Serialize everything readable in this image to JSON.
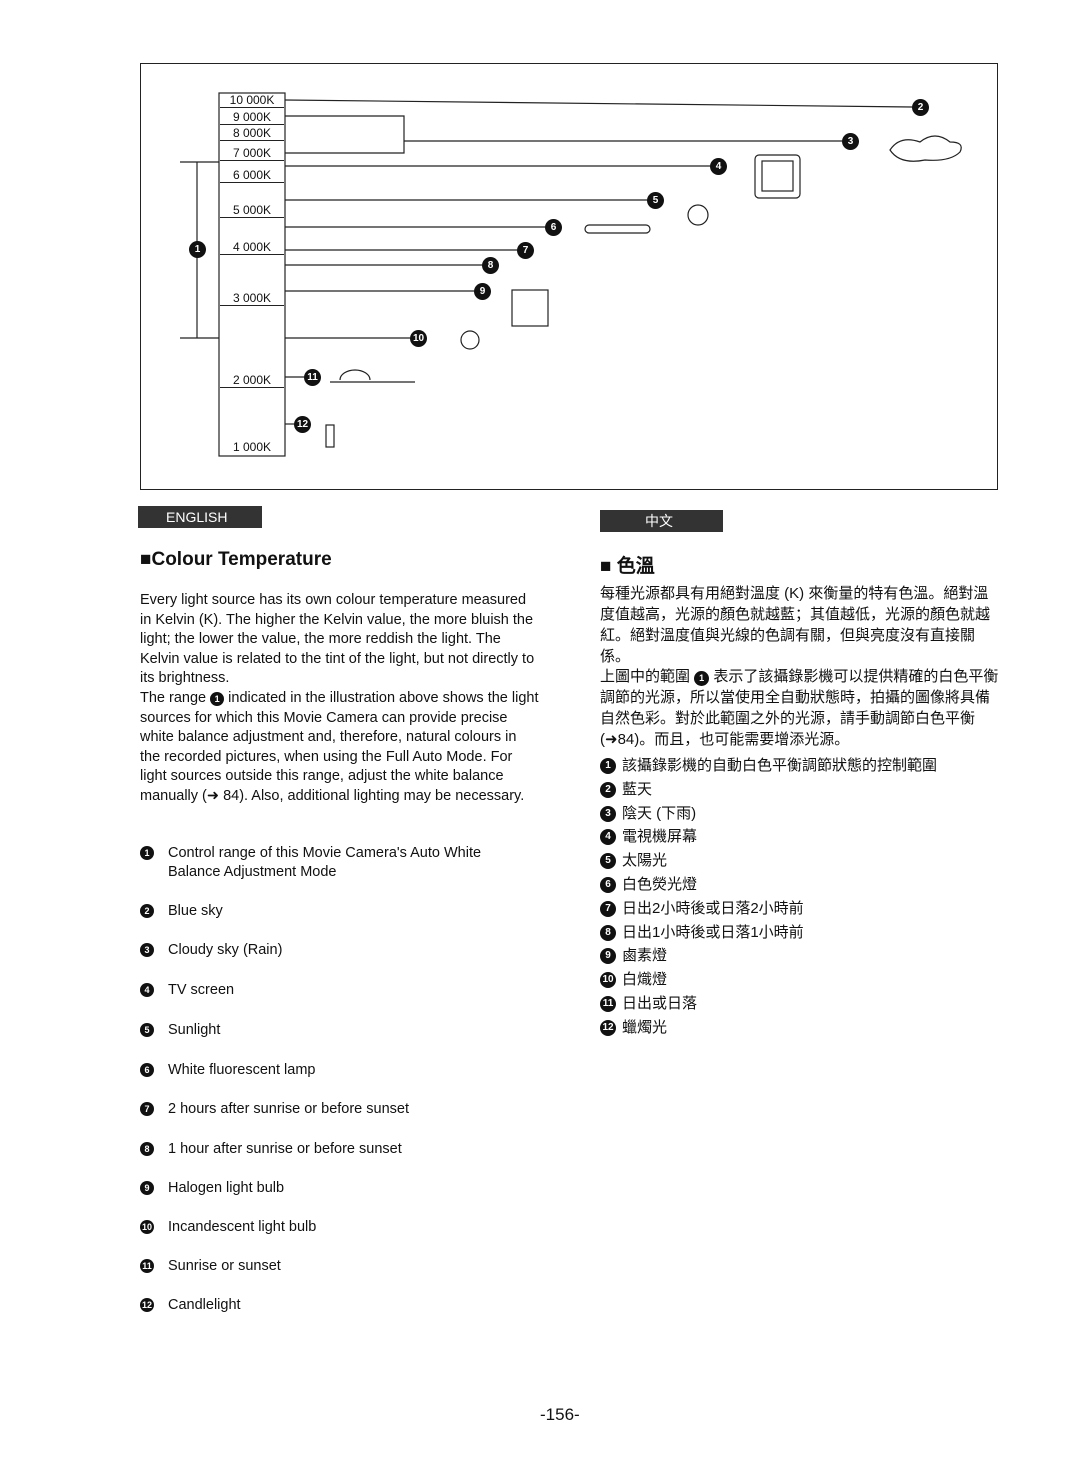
{
  "diagram": {
    "kelvin": [
      "10 000K",
      "9 000K",
      "8 000K",
      "7 000K",
      "6 000K",
      "5 000K",
      "4 000K",
      "3 000K",
      "2 000K",
      "1 000K"
    ],
    "markers": [
      "1",
      "2",
      "3",
      "4",
      "5",
      "6",
      "7",
      "8",
      "9",
      "10",
      "11",
      "12"
    ]
  },
  "english": {
    "tab": "ENGLISH",
    "heading": "Colour Temperature",
    "para1": "Every light source has its own colour temperature measured in Kelvin (K). The higher the Kelvin value, the more bluish the light; the lower the value, the more reddish the light. The Kelvin value is related to the tint of the light, but not directly to its brightness.",
    "para2a": "The range ",
    "para2b": " indicated in the illustration above shows the light sources for which this Movie Camera can provide precise white balance adjustment and, therefore, natural colours in the recorded pictures, when using the Full Auto Mode. For light sources outside this range, adjust the white balance manually (➜ 84). Also, additional lighting may be necessary.",
    "items": [
      "Control range of this Movie Camera's Auto White Balance Adjustment Mode",
      "Blue sky",
      "Cloudy sky (Rain)",
      "TV screen",
      "Sunlight",
      "White fluorescent lamp",
      "2 hours after sunrise or before sunset",
      "1 hour after sunrise or before sunset",
      "Halogen light bulb",
      "Incandescent light bulb",
      "Sunrise or sunset",
      "Candlelight"
    ]
  },
  "chinese": {
    "tab": "中文",
    "heading": "色溫",
    "para1": "每種光源都具有用絕對溫度 (K) 來衡量的特有色溫。絕對溫度值越高，光源的顏色就越藍；其值越低，光源的顏色就越紅。絕對溫度值與光線的色調有關，但與亮度沒有直接關係。",
    "para2a": "上圖中的範圍 ",
    "para2b": " 表示了該攝錄影機可以提供精確的白色平衡調節的光源，所以當使用全自動狀態時，拍攝的圖像將具備自然色彩。對於此範圍之外的光源，請手動調節白色平衡 (➜84)。而且，也可能需要增添光源。",
    "items": [
      "該攝錄影機的自動白色平衡調節狀態的控制範圍",
      "藍天",
      "陰天 (下雨)",
      "電視機屏幕",
      "太陽光",
      "白色熒光燈",
      "日出2小時後或日落2小時前",
      "日出1小時後或日落1小時前",
      "鹵素燈",
      "白熾燈",
      "日出或日落",
      "蠟燭光"
    ]
  },
  "page_number": "-156-"
}
